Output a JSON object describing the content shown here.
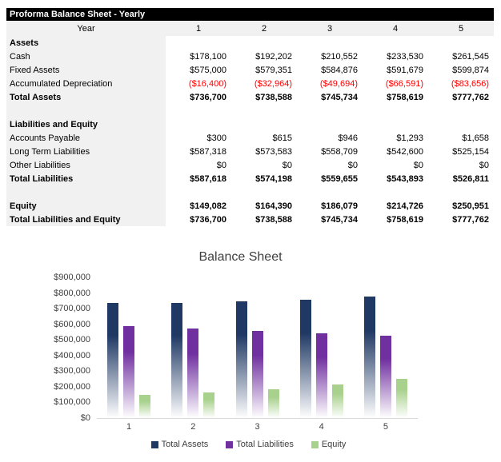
{
  "header": {
    "title": "Proforma Balance Sheet - Yearly"
  },
  "table": {
    "year_label": "Year",
    "year_columns": [
      "1",
      "2",
      "3",
      "4",
      "5"
    ],
    "rows": [
      {
        "label": "Assets",
        "style": "section",
        "values": [
          "",
          "",
          "",
          "",
          ""
        ]
      },
      {
        "label": "Cash",
        "style": "normal",
        "values": [
          "$178,100",
          "$192,202",
          "$210,552",
          "$233,530",
          "$261,545"
        ]
      },
      {
        "label": "Fixed Assets",
        "style": "normal",
        "values": [
          "$575,000",
          "$579,351",
          "$584,876",
          "$591,679",
          "$599,874"
        ]
      },
      {
        "label": "Accumulated Depreciation",
        "style": "negative",
        "values": [
          "($16,400)",
          "($32,964)",
          "($49,694)",
          "($66,591)",
          "($83,656)"
        ]
      },
      {
        "label": "Total Assets",
        "style": "total",
        "values": [
          "$736,700",
          "$738,588",
          "$745,734",
          "$758,619",
          "$777,762"
        ]
      },
      {
        "label": "",
        "style": "spacer",
        "values": [
          "",
          "",
          "",
          "",
          ""
        ]
      },
      {
        "label": "Liabilities and Equity",
        "style": "section",
        "values": [
          "",
          "",
          "",
          "",
          ""
        ]
      },
      {
        "label": "Accounts Payable",
        "style": "normal",
        "values": [
          "$300",
          "$615",
          "$946",
          "$1,293",
          "$1,658"
        ]
      },
      {
        "label": "Long Term Liabilities",
        "style": "normal",
        "values": [
          "$587,318",
          "$573,583",
          "$558,709",
          "$542,600",
          "$525,154"
        ]
      },
      {
        "label": "Other Liabilities",
        "style": "normal",
        "values": [
          "$0",
          "$0",
          "$0",
          "$0",
          "$0"
        ]
      },
      {
        "label": "Total Liabilities",
        "style": "total",
        "values": [
          "$587,618",
          "$574,198",
          "$559,655",
          "$543,893",
          "$526,811"
        ]
      },
      {
        "label": "",
        "style": "spacer",
        "values": [
          "",
          "",
          "",
          "",
          ""
        ]
      },
      {
        "label": "Equity",
        "style": "total",
        "values": [
          "$149,082",
          "$164,390",
          "$186,079",
          "$214,726",
          "$250,951"
        ]
      },
      {
        "label": "Total Liabilities and Equity",
        "style": "total",
        "values": [
          "$736,700",
          "$738,588",
          "$745,734",
          "$758,619",
          "$777,762"
        ]
      }
    ]
  },
  "chart_data": {
    "type": "bar",
    "title": "Balance Sheet",
    "categories": [
      "1",
      "2",
      "3",
      "4",
      "5"
    ],
    "series": [
      {
        "name": "Total Assets",
        "color": "#1F3864",
        "values": [
          736700,
          738588,
          745734,
          758619,
          777762
        ]
      },
      {
        "name": "Total Liabilities",
        "color": "#7030A0",
        "values": [
          587618,
          574198,
          559655,
          543893,
          526811
        ]
      },
      {
        "name": "Equity",
        "color": "#A9D18E",
        "values": [
          149082,
          164390,
          186079,
          214726,
          250951
        ]
      }
    ],
    "ylim": [
      0,
      900000
    ],
    "ytick_step": 100000,
    "ytick_labels": [
      "$0",
      "$100,000",
      "$200,000",
      "$300,000",
      "$400,000",
      "$500,000",
      "$600,000",
      "$700,000",
      "$800,000",
      "$900,000"
    ],
    "xlabel": "",
    "ylabel": "",
    "grid": false,
    "legend_position": "bottom",
    "bar_style": "vertical gradient, solid color at top fading to white at bottom"
  },
  "colors": {
    "title_bar_bg": "#000000",
    "title_bar_text": "#FFFFFF",
    "label_column_bg": "#F1F1F1",
    "negative_value": "#FF0000",
    "axis_line": "#D9D9D9",
    "chart_text": "#404040"
  }
}
